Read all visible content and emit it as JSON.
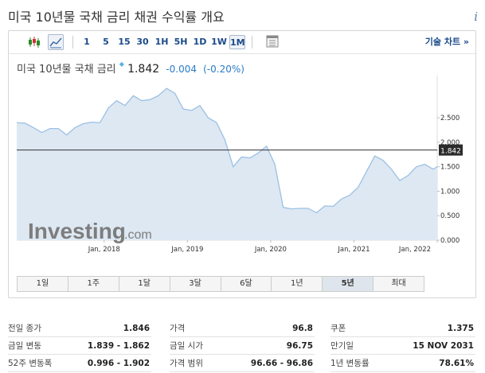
{
  "page": {
    "title": "미국 10년물 국채 금리  채권 수익률 개요",
    "info_label": "i"
  },
  "toolbar": {
    "candle_icon": "candlestick-icon",
    "line_icon": "line-chart-icon",
    "intervals": [
      "1",
      "5",
      "15",
      "30",
      "1H",
      "5H",
      "1D",
      "1W",
      "1M"
    ],
    "active_interval": "1M",
    "settings_icon": "document-icon",
    "tech_chart": "기술 차트 »"
  },
  "quote": {
    "name": "미국 10년물 국채 금리",
    "price": "1.842",
    "change": "-0.004",
    "change_pct": "(-0.20%)"
  },
  "watermark": {
    "brand": "Investing",
    "suffix": ".com"
  },
  "ranges": [
    "1일",
    "1주",
    "1달",
    "3달",
    "6달",
    "1년",
    "5년",
    "최대"
  ],
  "active_range": "5년",
  "stats": {
    "col1": [
      {
        "k": "전일 종가",
        "v": "1.846"
      },
      {
        "k": "금일 변동",
        "v": "1.839 - 1.862"
      },
      {
        "k": "52주 변동폭",
        "v": "0.996 - 1.902"
      }
    ],
    "col2": [
      {
        "k": "가격",
        "v": "96.8"
      },
      {
        "k": "금일 시가",
        "v": "96.75"
      },
      {
        "k": "가격 범위",
        "v": "96.66 - 96.86"
      }
    ],
    "col3": [
      {
        "k": "쿠폰",
        "v": "1.375"
      },
      {
        "k": "만기일",
        "v": "15 NOV 2031"
      },
      {
        "k": "1년 변동률",
        "v": "78.61%"
      }
    ]
  },
  "chart_data": {
    "type": "area",
    "x_ticks": [
      "Jan, 2018",
      "Jan, 2019",
      "Jan, 2020",
      "Jan, 2021",
      "Jan, 2022"
    ],
    "y_ticks": [
      "2.500",
      "2.000",
      "1.500",
      "1.000",
      "0.500",
      "0.000"
    ],
    "ylim": [
      0,
      3.2
    ],
    "current_value": 1.842,
    "current_label": "1.842",
    "series": [
      {
        "x": [
          2016.95,
          2017.05,
          2017.15,
          2017.25,
          2017.35,
          2017.45,
          2017.55,
          2017.65,
          2017.75,
          2017.85,
          2017.95,
          2018.05,
          2018.15,
          2018.25,
          2018.35,
          2018.45,
          2018.55,
          2018.65,
          2018.75,
          2018.85,
          2018.95,
          2019.05,
          2019.15,
          2019.25,
          2019.35,
          2019.45,
          2019.55,
          2019.65,
          2019.75,
          2019.85,
          2019.95,
          2020.05,
          2020.15,
          2020.25,
          2020.35,
          2020.45,
          2020.55,
          2020.65,
          2020.75,
          2020.85,
          2020.95,
          2021.05,
          2021.15,
          2021.25,
          2021.35,
          2021.45,
          2021.55,
          2021.65,
          2021.75,
          2021.85,
          2021.95,
          2022.0
        ],
        "values": [
          2.4,
          2.39,
          2.3,
          2.2,
          2.28,
          2.28,
          2.15,
          2.3,
          2.38,
          2.41,
          2.4,
          2.7,
          2.85,
          2.75,
          2.95,
          2.85,
          2.87,
          2.95,
          3.1,
          3.0,
          2.68,
          2.65,
          2.75,
          2.5,
          2.4,
          2.05,
          1.5,
          1.7,
          1.68,
          1.78,
          1.92,
          1.55,
          0.67,
          0.64,
          0.65,
          0.65,
          0.56,
          0.7,
          0.69,
          0.84,
          0.92,
          1.08,
          1.4,
          1.72,
          1.63,
          1.45,
          1.22,
          1.32,
          1.5,
          1.55,
          1.45,
          1.5
        ]
      }
    ]
  }
}
